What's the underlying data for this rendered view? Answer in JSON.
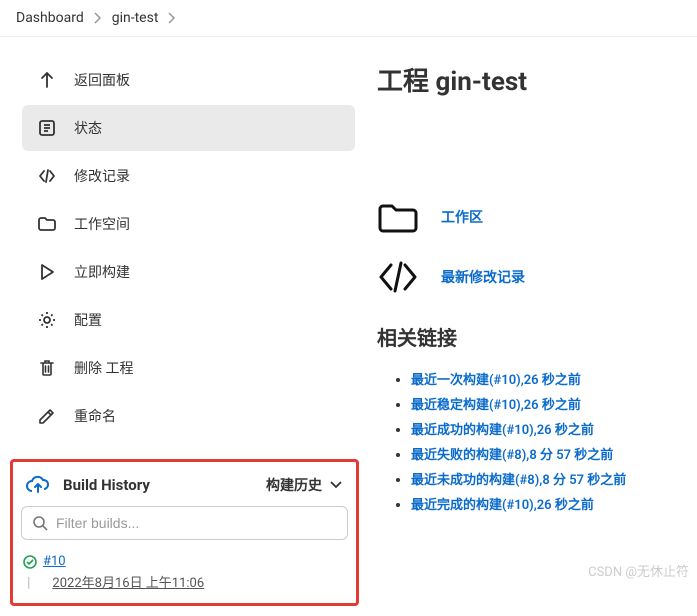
{
  "breadcrumb": {
    "items": [
      "Dashboard",
      "gin-test"
    ]
  },
  "sidebar": {
    "items": [
      {
        "icon": "arrow-up-icon",
        "label": "返回面板"
      },
      {
        "icon": "status-icon",
        "label": "状态"
      },
      {
        "icon": "code-icon",
        "label": "修改记录"
      },
      {
        "icon": "folder-icon",
        "label": "工作空间"
      },
      {
        "icon": "play-icon",
        "label": "立即构建"
      },
      {
        "icon": "gear-icon",
        "label": "配置"
      },
      {
        "icon": "trash-icon",
        "label": "删除 工程"
      },
      {
        "icon": "edit-icon",
        "label": "重命名"
      }
    ]
  },
  "build_history": {
    "title": "Build History",
    "toggle_label": "构建历史",
    "filter_placeholder": "Filter builds...",
    "builds": [
      {
        "status": "success",
        "number": "#10",
        "date": "2022年8月16日 上午11:06"
      }
    ]
  },
  "main": {
    "title": "工程 gin-test",
    "actions": [
      {
        "icon": "folder-large-icon",
        "label": "工作区"
      },
      {
        "icon": "code-large-icon",
        "label": "最新修改记录"
      }
    ],
    "related_title": "相关链接",
    "links": [
      "最近一次构建(#10),26 秒之前",
      "最近稳定构建(#10),26 秒之前",
      "最近成功的构建(#10),26 秒之前",
      "最近失败的构建(#8),8 分 57 秒之前",
      "最近未成功的构建(#8),8 分 57 秒之前",
      "最近完成的构建(#10),26 秒之前"
    ]
  },
  "watermark": "CSDN @无休止符"
}
